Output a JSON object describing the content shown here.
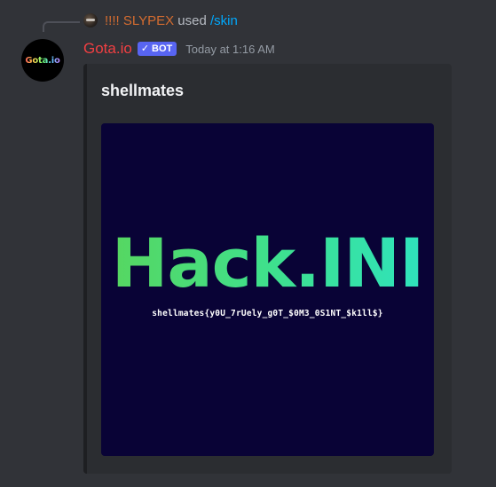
{
  "reply": {
    "username": "!!!! SLYPEX",
    "action": "used",
    "command": "/skin"
  },
  "message": {
    "avatar_text": "Gota.io",
    "username": "Gota.io",
    "badge_check": "✓",
    "badge_label": "BOT",
    "timestamp": "Today at 1:16 AM"
  },
  "embed": {
    "title": "shellmates",
    "image": {
      "headline": "Hack.INI",
      "flag_text": "shellmates{y0U_7rUely_g0T_$0M3_0S1NT_$k1ll$}"
    }
  },
  "colors": {
    "background": "#313338",
    "embed_bg": "#2b2d31",
    "username": "#f23f42",
    "reply_user": "#d46c30",
    "command": "#00a8fc",
    "bot_badge": "#5865f2",
    "image_bg": "#090336"
  }
}
